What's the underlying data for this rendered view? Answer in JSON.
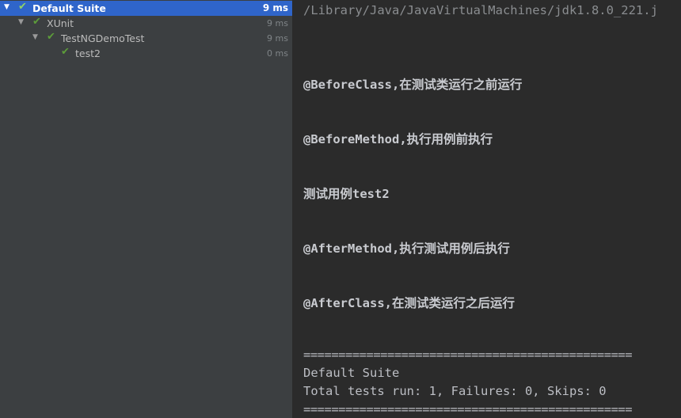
{
  "test_tree": {
    "items": [
      {
        "label": "Default Suite",
        "time": "9 ms"
      },
      {
        "label": "XUnit",
        "time": "9 ms"
      },
      {
        "label": "TestNGDemoTest",
        "time": "9 ms"
      },
      {
        "label": "test2",
        "time": "0 ms"
      }
    ]
  },
  "console": {
    "path": "/Library/Java/JavaVirtualMachines/jdk1.8.0_221.j",
    "lines": [
      "@BeforeClass,在测试类运行之前运行",
      "@BeforeMethod,执行用例前执行",
      "测试用例test2",
      "@AfterMethod,执行测试用例后执行",
      "@AfterClass,在测试类运行之后运行"
    ],
    "separator": "===============================================",
    "suite_name": "Default Suite",
    "summary": "Total tests run: 1, Failures: 0, Skips: 0"
  },
  "colors": {
    "selection": "#2f65ca",
    "pass_check": "#5c9c3a",
    "tree_bg": "#3c3f41",
    "console_bg": "#2b2b2b"
  }
}
